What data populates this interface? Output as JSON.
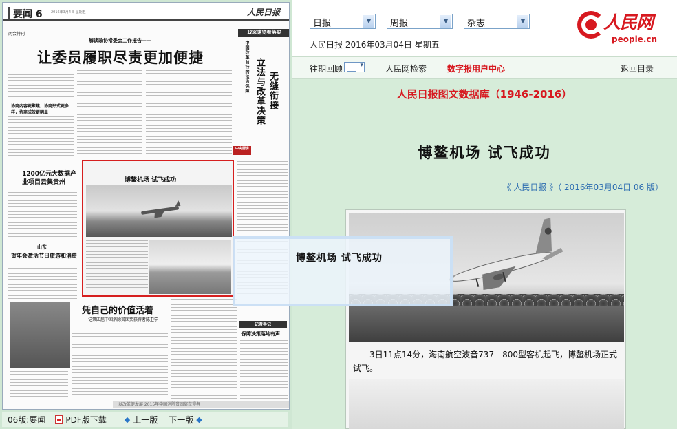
{
  "newspaper": {
    "section_label": "要闻",
    "page_num": "6",
    "date_small": "2016年3月4日 星期五",
    "masthead": "人民日报",
    "corner_tag": "政采速览看落实",
    "header_tag": "两会特刊",
    "sub_headline": "解读政协常委会工作报告——",
    "main_headline": "让委员履职尽责更加便捷",
    "vertical_head_1": "立法与改革决策",
    "vertical_head_2": "无缝衔接",
    "side_vertical": "中国改革前行的法治保障",
    "story_1": "1200亿元大数据产业项目云集贵州",
    "story_2": "贺年会激活节日旅游和消费",
    "story_2_region": "山东",
    "boxed_story": "博鳌机场  试飞成功",
    "feature_head": "凭自己的价值活着",
    "feature_sub": "——记第四届中国消除贫困奖获得者陈卫宁",
    "comment_label": "记者手记",
    "comment_head": "保障决策落地有声",
    "small_head_1": "协商内容更聚焦，协商形式更多样，协商成效更明显",
    "badge_red": "中央厨房",
    "footer_band": "以改革促发展·2015年中国消除贫困奖获得者"
  },
  "pager": {
    "current": "06版:要闻",
    "pdf": "PDF版下载",
    "prev": "上一版",
    "next": "下一版"
  },
  "selectors": [
    {
      "label": "日报"
    },
    {
      "label": "周报"
    },
    {
      "label": "杂志"
    }
  ],
  "dateline": "人民日报  2016年03月04日  星期五",
  "logo": {
    "name": "人民网",
    "url": "people.cn"
  },
  "nav": {
    "archive": "往期回顾",
    "search": "人民网检索",
    "user_center": "数字报用户中心",
    "back": "返回目录"
  },
  "database_title": "人民日报图文数据库（1946-2016）",
  "article": {
    "title": "博鳌机场   试飞成功",
    "source": "《 人民日报 》（ 2016年03月04日   06 版）",
    "caption": "3日11点14分，海南航空波音737—800型客机起飞，博鳌机场正式试飞。"
  },
  "popup": {
    "title": "博鳌机场   试飞成功"
  },
  "colors": {
    "brand_red": "#d71920",
    "link_blue": "#2c6cb0",
    "page_bg": "#d6ecd9",
    "highlight_box": "#d61f1f"
  }
}
